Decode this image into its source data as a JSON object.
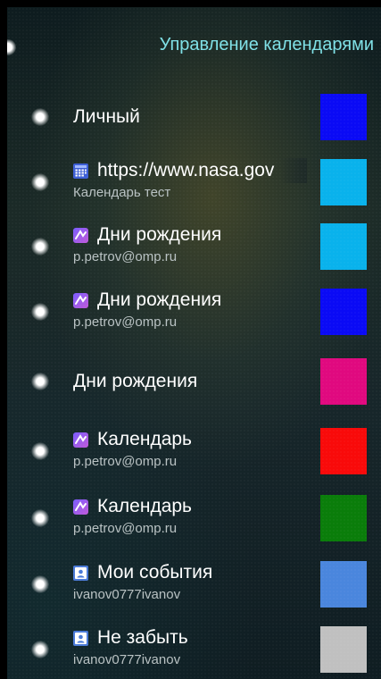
{
  "header": {
    "title": "Управление календарями"
  },
  "calendars": [
    {
      "title": "Личный",
      "subtitle": "",
      "icon": "none",
      "color": "#0a0af5"
    },
    {
      "title": "https://www.nasa.gov",
      "subtitle": "Календарь тест",
      "icon": "calendar-grid-icon",
      "color": "#09b2ec"
    },
    {
      "title": "Дни рождения",
      "subtitle": "p.petrov@omp.ru",
      "icon": "account-sync-icon",
      "color": "#09b2ec"
    },
    {
      "title": "Дни рождения",
      "subtitle": "p.petrov@omp.ru",
      "icon": "account-sync-icon",
      "color": "#0a0af5"
    },
    {
      "title": "Дни рождения",
      "subtitle": "",
      "icon": "none",
      "color": "#e0097f"
    },
    {
      "title": "Календарь",
      "subtitle": "p.petrov@omp.ru",
      "icon": "account-sync-icon",
      "color": "#f90a0a"
    },
    {
      "title": "Календарь",
      "subtitle": "p.petrov@omp.ru",
      "icon": "account-sync-icon",
      "color": "#0a7d0a"
    },
    {
      "title": "Мои события",
      "subtitle": "ivanov0777ivanov",
      "icon": "contact-card-icon",
      "color": "#4a86dd"
    },
    {
      "title": "Не забыть",
      "subtitle": "ivanov0777ivanov",
      "icon": "contact-card-icon",
      "color": "#c0c0c0"
    }
  ]
}
